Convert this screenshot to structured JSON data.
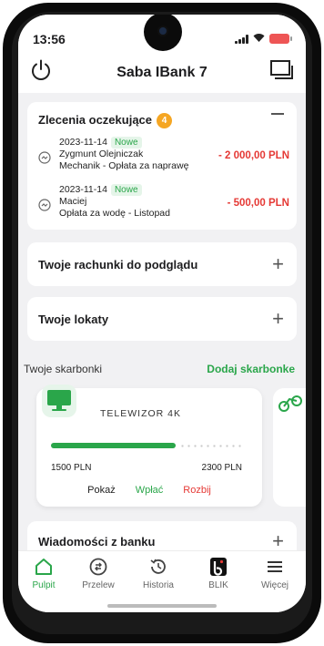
{
  "status_bar": {
    "time": "13:56"
  },
  "header": {
    "title": "Saba IBank 7"
  },
  "pending_orders": {
    "title": "Zlecenia oczekujące",
    "count": "4",
    "items": [
      {
        "date": "2023-11-14",
        "tag": "Nowe",
        "name": "Zygmunt Olejniczak",
        "description": "Mechanik - Opłata za naprawę",
        "amount": "- 2 000,00 PLN"
      },
      {
        "date": "2023-11-14",
        "tag": "Nowe",
        "name": "Maciej",
        "description": "Opłata za wodę - Listopad",
        "amount": "- 500,00 PLN"
      }
    ]
  },
  "accounts_preview": {
    "title": "Twoje rachunki do podglądu"
  },
  "deposits": {
    "title": "Twoje lokaty"
  },
  "piggy_banks": {
    "label": "Twoje skarbonki",
    "add_label": "Dodaj skarbonke",
    "items": [
      {
        "icon": "tv-icon",
        "name": "TELEWIZOR 4K",
        "current": "1500 PLN",
        "target": "2300 PLN",
        "progress_fraction": 0.65,
        "actions": {
          "show": "Pokaż",
          "deposit": "Wpłać",
          "break": "Rozbij"
        }
      }
    ]
  },
  "bank_messages": {
    "title": "Wiadomości z banku"
  },
  "bottom_nav": {
    "items": [
      {
        "label": "Pulpit",
        "icon": "home-icon",
        "active": true
      },
      {
        "label": "Przelew",
        "icon": "transfer-icon",
        "active": false
      },
      {
        "label": "Historia",
        "icon": "history-icon",
        "active": false
      },
      {
        "label": "BLIK",
        "icon": "blik-icon",
        "active": false
      },
      {
        "label": "Więcej",
        "icon": "menu-icon",
        "active": false
      }
    ]
  },
  "colors": {
    "accent_green": "#2aa64a",
    "amount_red": "#e53935",
    "badge_orange": "#f5a623"
  }
}
